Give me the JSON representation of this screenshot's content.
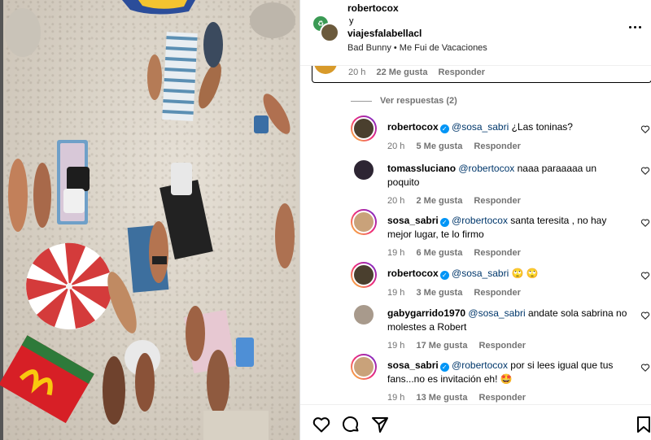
{
  "header": {
    "user1": "robertocox",
    "and": "y",
    "user2": "viajesfalabellacl",
    "music": "Bad Bunny • Me Fui de Vacaciones"
  },
  "previous": {
    "time": "20 h",
    "likes": "22 Me gusta",
    "reply": "Responder"
  },
  "view_replies": "Ver respuestas (2)",
  "comments": [
    {
      "user": "robertocox",
      "verified": true,
      "mention": "@sosa_sabri",
      "text": " ¿Las toninas?",
      "text2": "",
      "time": "20 h",
      "likes": "5 Me gusta",
      "reply": "Responder",
      "avatar_color": "#4a3f2e"
    },
    {
      "user": "tomassluciano",
      "verified": false,
      "mention": "@robertocox",
      "text": " naaa paraaaaa un",
      "text2": "poquito",
      "time": "20 h",
      "likes": "2 Me gusta",
      "reply": "Responder",
      "avatar_color": "#2d2533"
    },
    {
      "user": "sosa_sabri",
      "verified": true,
      "mention": "@robertocox",
      "text": " santa teresita , no hay",
      "text2": "mejor lugar, te lo firmo",
      "time": "19 h",
      "likes": "6 Me gusta",
      "reply": "Responder",
      "avatar_color": "#c9a27a"
    },
    {
      "user": "robertocox",
      "verified": true,
      "mention": "@sosa_sabri",
      "text": " 🙄 🙄",
      "text2": "",
      "time": "19 h",
      "likes": "3 Me gusta",
      "reply": "Responder",
      "avatar_color": "#4a3f2e"
    },
    {
      "user": "gabygarrido1970",
      "verified": false,
      "mention": "@sosa_sabri",
      "text": " andate sola sabrina no",
      "text2": "molestes a Robert",
      "time": "19 h",
      "likes": "17 Me gusta",
      "reply": "Responder",
      "avatar_color": "#a89a8c"
    },
    {
      "user": "sosa_sabri",
      "verified": true,
      "mention": "@robertocox",
      "text": " por si lees igual que tus",
      "text2": "fans...no es invitación eh! 🤩",
      "time": "19 h",
      "likes": "13 Me gusta",
      "reply": "Responder",
      "avatar_color": "#c9a27a"
    }
  ]
}
